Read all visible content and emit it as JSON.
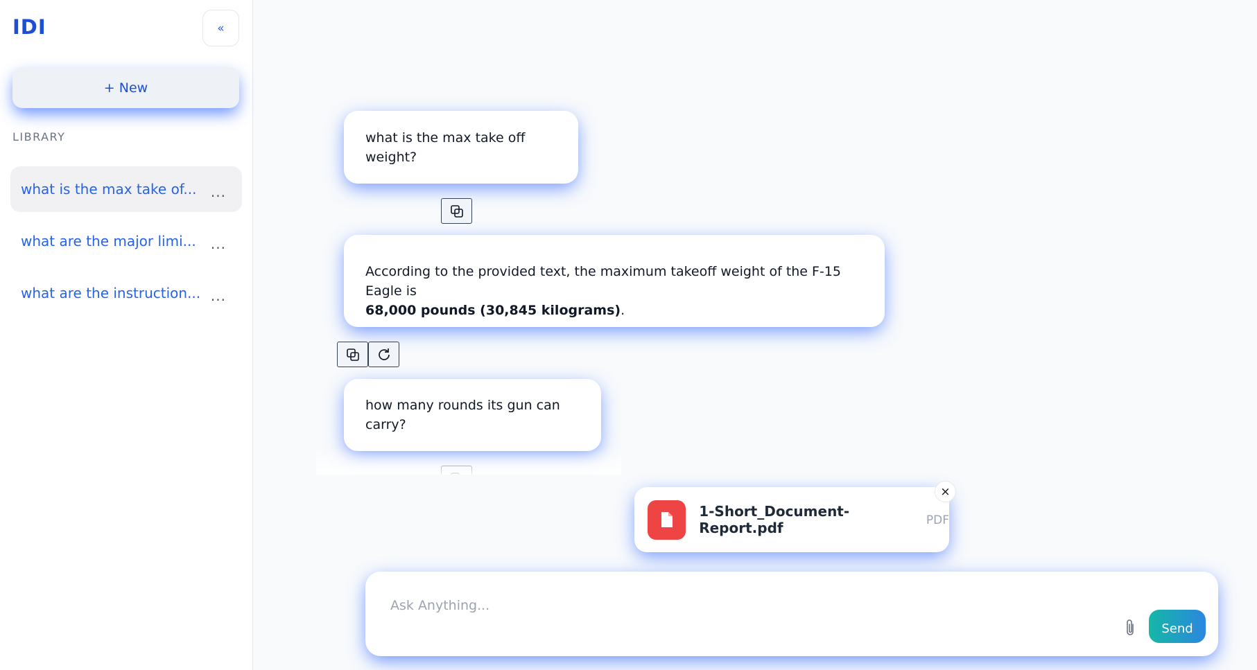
{
  "sidebar": {
    "logo": "IDI",
    "collapse_label": "«",
    "new_button_label": "+ New",
    "library_heading": "LIBRARY",
    "items": [
      {
        "label": "what is the max take of...",
        "more": "...",
        "active": true
      },
      {
        "label": "what are the major limi...",
        "more": "...",
        "active": false
      },
      {
        "label": "what are the instruction...",
        "more": "...",
        "active": false
      }
    ]
  },
  "chat": {
    "messages": [
      {
        "role": "user",
        "text": "what is the max take off weight?"
      },
      {
        "role": "assistant",
        "text_before": "According to the provided text, the maximum takeoff weight of the F-15 Eagle is",
        "text_bold": "68,000 pounds (30,845 kilograms)",
        "text_after": "."
      },
      {
        "role": "user",
        "text": "how many rounds its gun can carry?"
      }
    ],
    "icons": {
      "copy": "copy-icon",
      "regenerate": "refresh-icon"
    }
  },
  "attachment": {
    "file_name": "1-Short_Document-Report.pdf",
    "file_type": "PDF",
    "remove_label": "×",
    "icon": "file-icon",
    "icon_color": "#ef4444"
  },
  "composer": {
    "placeholder": "Ask Anything...",
    "value": "",
    "send_label": "Send",
    "attach_icon": "paperclip-icon"
  },
  "colors": {
    "accent": "#2563eb",
    "glow": "#3b6eff",
    "send_gradient_start": "#14b8a6",
    "send_gradient_end": "#2c86e0"
  }
}
